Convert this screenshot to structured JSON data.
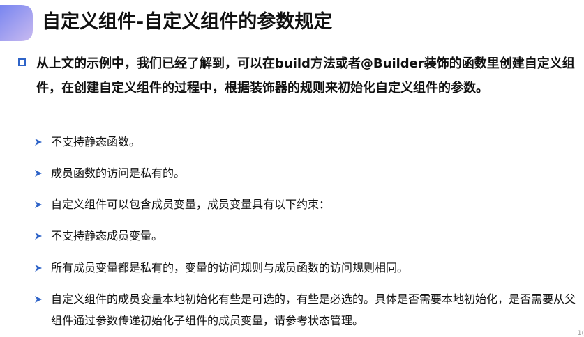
{
  "slide": {
    "title": "自定义组件-自定义组件的参数规定",
    "main_point": "从上文的示例中，我们已经了解到，可以在build方法或者@Builder装饰的函数里创建自定义组件，在创建自定义组件的过程中，根据装饰器的规则来初始化自定义组件的参数。",
    "bullets": [
      "不支持静态函数。",
      "成员函数的访问是私有的。",
      "自定义组件可以包含成员变量，成员变量具有以下约束：",
      "不支持静态成员变量。",
      "所有成员变量都是私有的，变量的访问规则与成员函数的访问规则相同。",
      "自定义组件的成员变量本地初始化有些是可选的，有些是必选的。具体是否需要本地初始化，是否需要从父组件通过参数传递初始化子组件的成员变量，请参考状态管理。"
    ],
    "page_number": "1("
  },
  "icons": {
    "title_decoration": "gradient-diamond-icon",
    "main_bullet": "square-bullet-icon",
    "sub_bullet": "arrow-bullet-icon"
  },
  "colors": {
    "accent_blue": "#2f64c8",
    "gradient_start": "#7c8cf2",
    "gradient_end": "#c7b8ee",
    "text": "#111111"
  }
}
